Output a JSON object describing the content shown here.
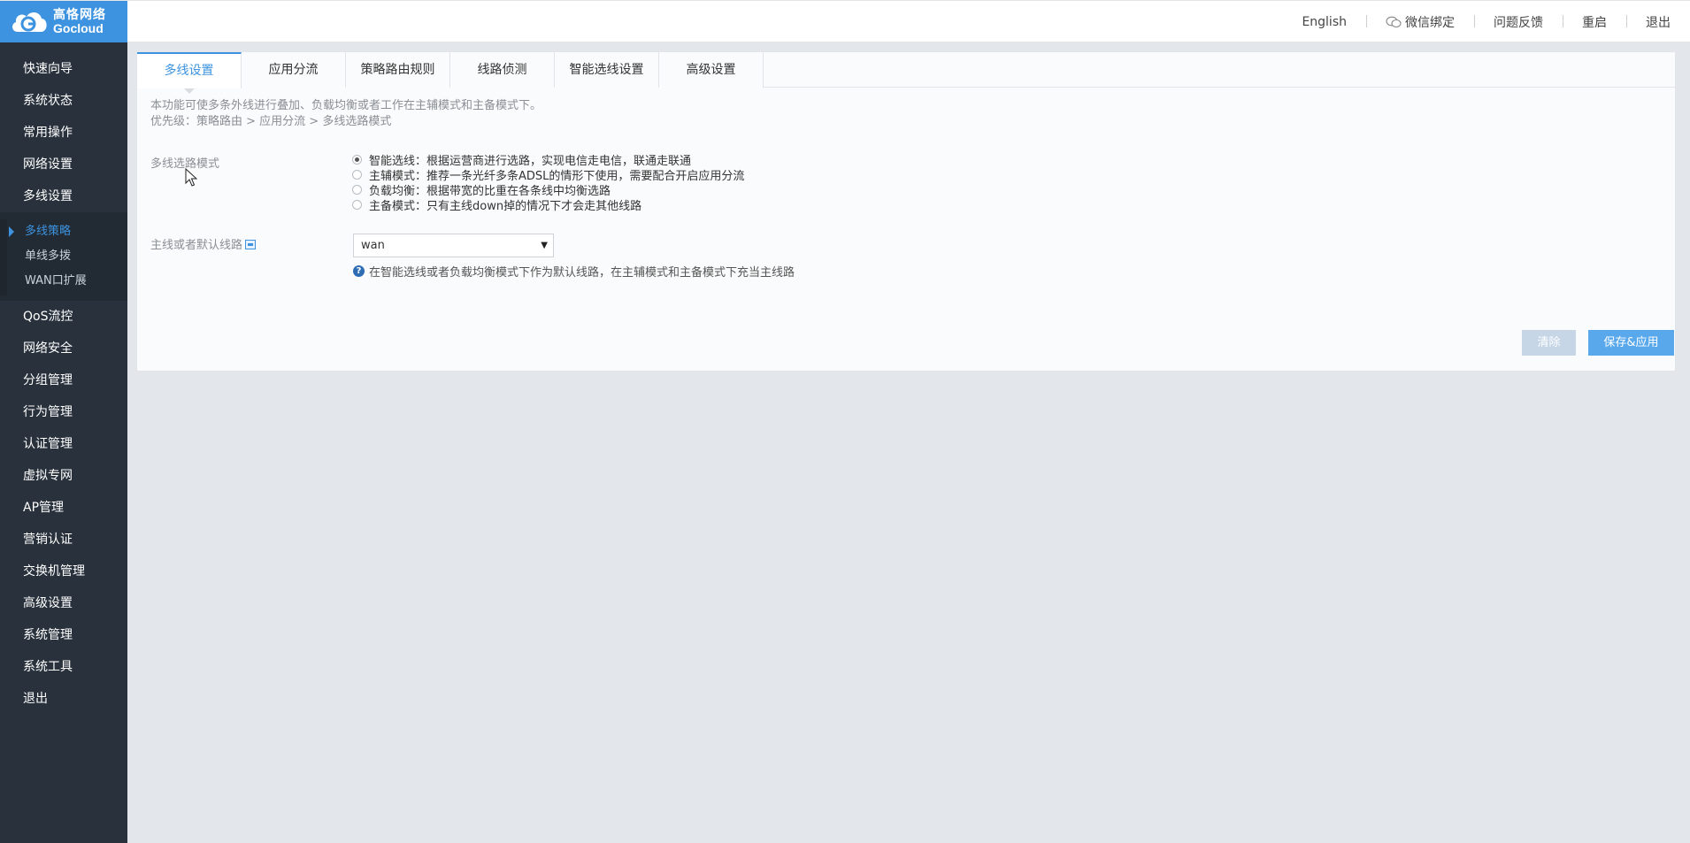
{
  "brand": {
    "name_cn": "高恪网络",
    "name_en": "Gocloud",
    "color": "#3d93df"
  },
  "topbar": {
    "links": [
      {
        "label": "English"
      },
      {
        "label": "微信绑定",
        "icon": "wechat-icon"
      },
      {
        "label": "问题反馈"
      },
      {
        "label": "重启"
      },
      {
        "label": "退出"
      }
    ]
  },
  "sidebar": {
    "items_top": [
      {
        "label": "快速向导"
      },
      {
        "label": "系统状态"
      },
      {
        "label": "常用操作"
      },
      {
        "label": "网络设置"
      },
      {
        "label": "多线设置"
      }
    ],
    "sub_items": [
      {
        "label": "多线策略",
        "active": true
      },
      {
        "label": "单线多拨"
      },
      {
        "label": "WAN口扩展"
      }
    ],
    "items_bottom": [
      {
        "label": "QoS流控"
      },
      {
        "label": "网络安全"
      },
      {
        "label": "分组管理"
      },
      {
        "label": "行为管理"
      },
      {
        "label": "认证管理"
      },
      {
        "label": "虚拟专网"
      },
      {
        "label": "AP管理"
      },
      {
        "label": "营销认证"
      },
      {
        "label": "交换机管理"
      },
      {
        "label": "高级设置"
      },
      {
        "label": "系统管理"
      },
      {
        "label": "系统工具"
      },
      {
        "label": "退出"
      }
    ]
  },
  "tabs": [
    {
      "label": "多线设置",
      "active": true
    },
    {
      "label": "应用分流"
    },
    {
      "label": "策略路由规则"
    },
    {
      "label": "线路侦测"
    },
    {
      "label": "智能选线设置"
    },
    {
      "label": "高级设置"
    }
  ],
  "description": {
    "line1": "本功能可使多条外线进行叠加、负载均衡或者工作在主辅模式和主备模式下。",
    "line2": "优先级：策略路由 > 应用分流 > 多线选路模式"
  },
  "mode": {
    "label": "多线选路模式",
    "options": [
      {
        "label": "智能选线：根据运营商进行选路，实现电信走电信，联通走联通",
        "checked": true
      },
      {
        "label": "主辅模式：推荐一条光纤多条ADSL的情形下使用，需要配合开启应用分流"
      },
      {
        "label": "负载均衡：根据带宽的比重在各条线中均衡选路"
      },
      {
        "label": "主备模式：只有主线down掉的情况下才会走其他线路"
      }
    ]
  },
  "default_line": {
    "label": "主线或者默认线路",
    "value": "wan",
    "hint": "在智能选线或者负载均衡模式下作为默认线路，在主辅模式和主备模式下充当主线路"
  },
  "buttons": {
    "clear": "清除",
    "save": "保存&应用"
  }
}
